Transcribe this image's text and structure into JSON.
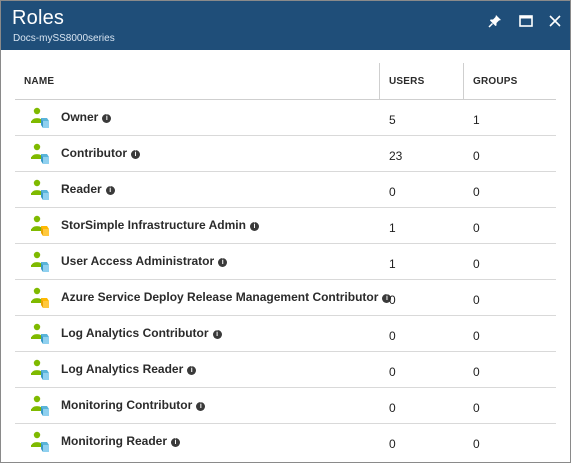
{
  "header": {
    "title": "Roles",
    "subtitle": "Docs-mySS8000series",
    "pin_icon": "pin-icon",
    "maximize_icon": "maximize-icon",
    "close_icon": "close-icon",
    "background": "#1f4e79"
  },
  "table": {
    "columns": [
      "NAME",
      "USERS",
      "GROUPS"
    ],
    "rows": [
      {
        "name": "Owner",
        "users": "5",
        "groups": "1"
      },
      {
        "name": "Contributor",
        "users": "23",
        "groups": "0"
      },
      {
        "name": "Reader",
        "users": "0",
        "groups": "0"
      },
      {
        "name": "StorSimple Infrastructure Admin",
        "users": "1",
        "groups": "0"
      },
      {
        "name": "User Access Administrator",
        "users": "1",
        "groups": "0"
      },
      {
        "name": "Azure Service Deploy Release Management Contributor",
        "users": "0",
        "groups": "0"
      },
      {
        "name": "Log Analytics Contributor",
        "users": "0",
        "groups": "0"
      },
      {
        "name": "Log Analytics Reader",
        "users": "0",
        "groups": "0"
      },
      {
        "name": "Monitoring Contributor",
        "users": "0",
        "groups": "0"
      },
      {
        "name": "Monitoring Reader",
        "users": "0",
        "groups": "0"
      }
    ],
    "row_icon": "user-role-icon",
    "info_icon": "info-icon"
  }
}
